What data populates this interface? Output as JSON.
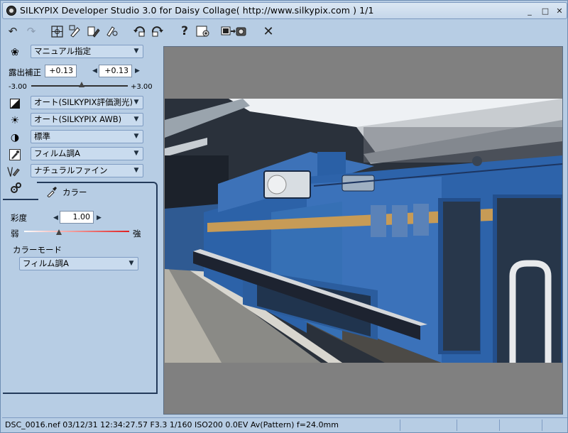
{
  "title": {
    "text": "SILKYPIX Developer Studio 3.0 for Daisy Collage( http://www.silkypix.com )  1/1",
    "minimize": "_",
    "maximize": "□",
    "close": "✕"
  },
  "toolbar": {
    "icons": [
      "undo-icon",
      "redo-icon",
      "grid-icon",
      "develop-icon",
      "batch-develop-icon",
      "paste-icon",
      "rotate-left-icon",
      "rotate-right-icon",
      "help-icon",
      "preferences-icon",
      "camera-icon",
      "close-icon"
    ]
  },
  "params": {
    "taste_select": "マニュアル指定",
    "exposure_label": "露出補正",
    "exposure_value1": "+0.13",
    "exposure_value2": "+0.13",
    "exposure_min": "-3.00",
    "exposure_max": "+3.00",
    "exposure_level": 0.52,
    "metering_select": "オート(SILKYPIX評価測光)",
    "wb_select": "オート(SILKYPIX AWB)",
    "contrast_select": "標準",
    "color_select": "フィルム調A",
    "sharpness_select": "ナチュラルファイン"
  },
  "color_tab": {
    "tab_label": "カラー",
    "saturation_label": "彩度",
    "saturation_value": "1.00",
    "weak_label": "弱",
    "strong_label": "強",
    "saturation_level": 0.33,
    "color_mode_label": "カラーモード",
    "color_mode_select": "フィルム調A"
  },
  "status": {
    "text": "DSC_0016.nef 03/12/31 12:34:27.57 F3.3 1/160 ISO200  0.0EV Av(Pattern) f=24.0mm"
  },
  "colors": {
    "background": "#b7cde4",
    "select_fill": "#c9dbee",
    "preview_gray": "#808080",
    "accent_line": "#233a5a",
    "saturation_strong": "#e02020"
  }
}
